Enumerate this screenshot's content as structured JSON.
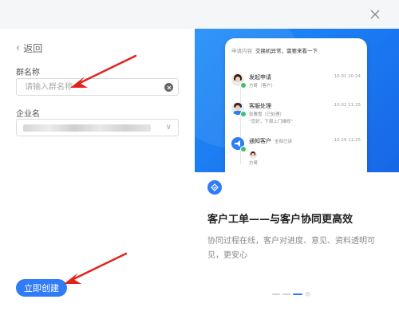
{
  "dialog": {
    "close_icon": "close-icon"
  },
  "form": {
    "back_label": "返回",
    "group_name_label": "群名称",
    "group_name_placeholder": "请输入群名称",
    "group_name_value": "",
    "corp_label": "企业名",
    "create_button_label": "立即创建"
  },
  "promo": {
    "phone_header_prefix": "申请内容",
    "phone_header_text": "交换机异常，需要来看一下",
    "timeline": [
      {
        "title": "发起申请",
        "sub": "方哥（客户）",
        "time": "10.01  10:24"
      },
      {
        "title": "客服处理",
        "sub": "张雅雪（已处理）",
        "sub2": "“您好，下周上门维修”",
        "time": "10.02  11:25"
      },
      {
        "title": "通知客户",
        "extra": "全部已读",
        "sub": "方哥",
        "time": "10.29  11:25"
      }
    ],
    "feature_title": "客户工单——与客户协同更高效",
    "feature_desc": "协同过程在线，客户对进度、意见、资料透明可见，更安心",
    "page_indicator": "同-"
  },
  "colors": {
    "accent": "#2f7cf6",
    "promo_bg": "#1a76f0",
    "success": "#3cc16b"
  }
}
